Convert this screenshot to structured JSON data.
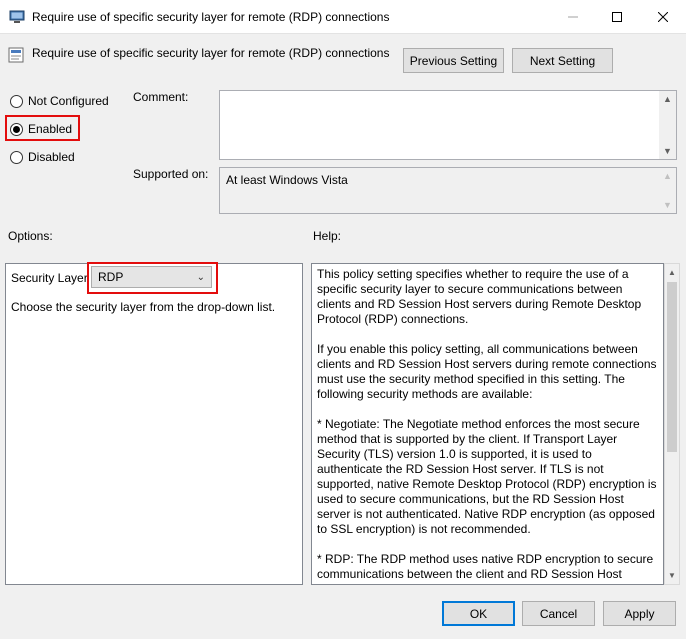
{
  "window": {
    "title": "Require use of specific security layer for remote (RDP) connections",
    "minimize_icon": "minimize-icon",
    "maximize_icon": "maximize-icon",
    "close_icon": "close-icon"
  },
  "header": {
    "policy_title": "Require use of specific security layer for remote (RDP) connections",
    "previous_label": "Previous Setting",
    "next_label": "Next Setting"
  },
  "state": {
    "options": [
      {
        "label": "Not Configured",
        "checked": false
      },
      {
        "label": "Enabled",
        "checked": true
      },
      {
        "label": "Disabled",
        "checked": false
      }
    ]
  },
  "comment": {
    "label": "Comment:",
    "value": ""
  },
  "supported": {
    "label": "Supported on:",
    "value": "At least Windows Vista"
  },
  "options_section": {
    "label": "Options:",
    "security_layer_label": "Security Layer",
    "security_layer_value": "RDP",
    "instruction": "Choose the security layer from the drop-down list."
  },
  "help_section": {
    "label": "Help:",
    "paragraphs": [
      "This policy setting specifies whether to require the use of a specific security layer to secure communications between clients and RD Session Host servers during Remote Desktop Protocol (RDP) connections.",
      "If you enable this policy setting, all communications between clients and RD Session Host servers during remote connections must use the security method specified in this setting. The following security methods are available:",
      "* Negotiate: The Negotiate method enforces the most secure method that is supported by the client. If Transport Layer Security (TLS) version 1.0 is supported, it is used to authenticate the RD Session Host server. If TLS is not supported, native Remote Desktop Protocol (RDP) encryption is used to secure communications, but the RD Session Host server is not authenticated. Native RDP encryption (as opposed to SSL encryption) is not recommended.",
      "* RDP: The RDP method uses native RDP encryption to secure communications between the client and RD Session Host server."
    ]
  },
  "footer": {
    "ok_label": "OK",
    "cancel_label": "Cancel",
    "apply_label": "Apply"
  },
  "colors": {
    "highlight": "#e30d0d",
    "default_button_border": "#0078d7"
  }
}
